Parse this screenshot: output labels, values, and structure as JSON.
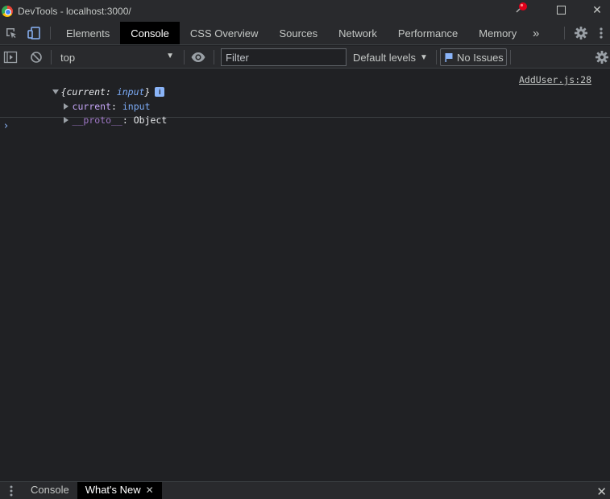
{
  "window": {
    "title": "DevTools - localhost:3000/",
    "minimize_glyph": "—",
    "maximize_glyph": "☐",
    "close_glyph": "✕"
  },
  "tabs": [
    {
      "label": "Elements",
      "active": false
    },
    {
      "label": "Console",
      "active": true
    },
    {
      "label": "CSS Overview",
      "active": false
    },
    {
      "label": "Sources",
      "active": false
    },
    {
      "label": "Network",
      "active": false
    },
    {
      "label": "Performance",
      "active": false
    },
    {
      "label": "Memory",
      "active": false
    }
  ],
  "more_tabs_glyph": "»",
  "toolbar": {
    "context": "top",
    "filter_placeholder": "Filter",
    "levels": "Default levels",
    "issues": "No Issues"
  },
  "console": {
    "log": {
      "source": "AddUser.js:28",
      "summary_open": "{",
      "summary_key": "current",
      "summary_colon": ": ",
      "summary_value": "input",
      "summary_close": "}",
      "info_badge": "i",
      "props": [
        {
          "key": "current",
          "sep": ": ",
          "value": "input"
        },
        {
          "key": "__proto__",
          "sep": ": ",
          "value": "Object"
        }
      ]
    },
    "prompt": "›"
  },
  "drawer": {
    "tabs": [
      {
        "label": "Console",
        "active": false
      },
      {
        "label": "What's New",
        "active": true
      }
    ],
    "close_glyph": "✕"
  },
  "colors": {
    "background": "#202124",
    "toolbar": "#292a2d",
    "accent": "#8ab4f8",
    "property_key": "#c5a5f7",
    "value": "#7cacf8",
    "pin": "#e0001a"
  },
  "icons": [
    "chrome-icon",
    "pin-icon",
    "inspect-icon",
    "device-toolbar-icon",
    "settings-icon",
    "kebab-menu-icon",
    "sidebar-toggle-icon",
    "clear-console-icon",
    "eye-icon",
    "flag-icon",
    "console-settings-icon",
    "drawer-menu-icon"
  ]
}
